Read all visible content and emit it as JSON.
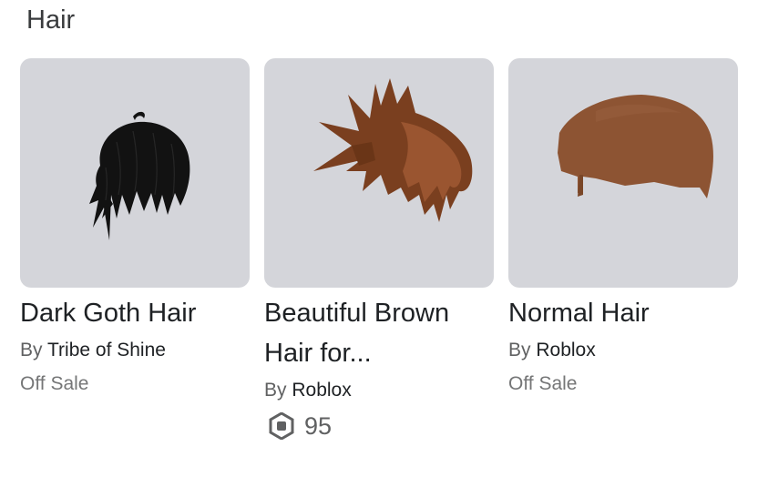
{
  "section": {
    "title": "Hair"
  },
  "items": [
    {
      "name": "Dark Goth Hair",
      "by_prefix": "By",
      "creator": "Tribe of Shine",
      "status": "Off Sale",
      "thumbnail_icon": "dark-goth-hair-thumbnail",
      "hair_color": "#101010"
    },
    {
      "name": "Beautiful Brown Hair for...",
      "by_prefix": "By",
      "creator": "Roblox",
      "price": "95",
      "currency_icon": "robux-icon",
      "thumbnail_icon": "beautiful-brown-hair-thumbnail",
      "hair_color": "#8a4a26"
    },
    {
      "name": "Normal Hair",
      "by_prefix": "By",
      "creator": "Roblox",
      "status": "Off Sale",
      "thumbnail_icon": "normal-hair-thumbnail",
      "hair_color": "#8d5433"
    }
  ]
}
